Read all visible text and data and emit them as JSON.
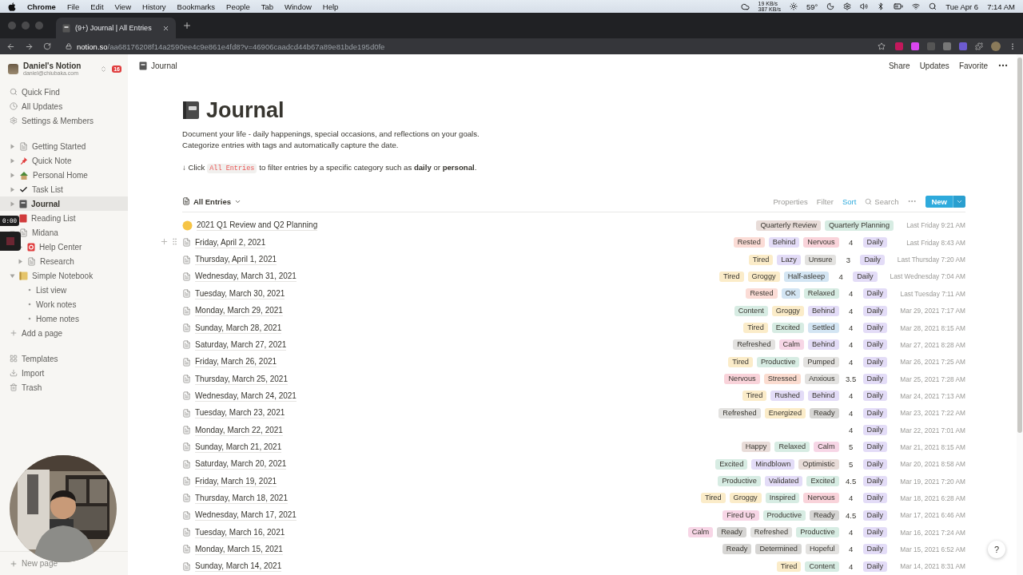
{
  "menubar": {
    "app": "Chrome",
    "menus": [
      "File",
      "Edit",
      "View",
      "History",
      "Bookmarks",
      "People",
      "Tab",
      "Window",
      "Help"
    ],
    "net_up": "19 KB/s",
    "net_down": "387 KB/s",
    "temperature": "59°",
    "date": "Tue Apr 6",
    "time": "7:14 AM"
  },
  "browser": {
    "tab_title": "(9+) Journal | All Entries",
    "url_host": "notion.so",
    "url_path": "/aa68176208f14a2590ee4c9e861e4fd8?v=46906caadcd44b67a89e81bde195d0fe"
  },
  "sidebar": {
    "workspace": "Daniel's Notion",
    "email": "daniel@chiubaka.com",
    "badge": "16",
    "actions": [
      {
        "label": "Quick Find",
        "kind": "search"
      },
      {
        "label": "All Updates",
        "kind": "clock"
      },
      {
        "label": "Settings & Members",
        "kind": "settings"
      }
    ],
    "pages": [
      {
        "label": "Getting Started",
        "kind": "page",
        "expanded": false,
        "selected": false
      },
      {
        "label": "Quick Note",
        "kind": "pin",
        "expanded": false,
        "selected": false
      },
      {
        "label": "Personal Home",
        "kind": "house",
        "expanded": false,
        "selected": false
      },
      {
        "label": "Task List",
        "kind": "check",
        "expanded": false,
        "selected": false
      },
      {
        "label": "Journal",
        "kind": "journal",
        "expanded": false,
        "selected": true
      },
      {
        "label": "Reading List",
        "kind": "book",
        "selected": false
      },
      {
        "label": "Midana",
        "kind": "page",
        "expanded": true,
        "selected": false,
        "children": [
          {
            "label": "Help Center",
            "kind": "help",
            "expanded": false,
            "selected": false
          },
          {
            "label": "Research",
            "kind": "page",
            "expanded": false,
            "selected": false
          }
        ]
      },
      {
        "label": "Simple Notebook",
        "kind": "notebook",
        "expanded": true,
        "selected": false,
        "children": [
          {
            "label": "List view",
            "kind": "bullet",
            "selected": false
          },
          {
            "label": "Work notes",
            "kind": "bullet",
            "selected": false
          },
          {
            "label": "Home notes",
            "kind": "bullet",
            "selected": false
          }
        ]
      }
    ],
    "add_page": "Add a page",
    "tools": [
      {
        "label": "Templates",
        "kind": "templates"
      },
      {
        "label": "Import",
        "kind": "import"
      },
      {
        "label": "Trash",
        "kind": "trash"
      }
    ],
    "new_page": "New page"
  },
  "recorder": {
    "timer": "0:00"
  },
  "topbar": {
    "breadcrumb": "Journal",
    "actions": [
      "Share",
      "Updates",
      "Favorite"
    ]
  },
  "page": {
    "title": "Journal",
    "description": [
      "Document your life - daily happenings, special occasions, and reflections on your goals.",
      "Categorize entries with tags and automatically capture the date."
    ],
    "hint": {
      "before": "↓ Click",
      "code": "All Entries",
      "after": "to filter entries by a specific category such as **daily** or **personal**."
    }
  },
  "view": {
    "name": "All Entries",
    "tools": [
      {
        "label": "Properties",
        "active": false
      },
      {
        "label": "Filter",
        "active": false
      },
      {
        "label": "Sort",
        "active": true
      }
    ],
    "search": "Search",
    "new_button": "New"
  },
  "rows": [
    {
      "title": "2021 Q1 Review and Q2 Planning",
      "kind": "emoji",
      "hovered": false,
      "tags": [
        {
          "label": "Quarterly Review",
          "color": "#e8dcd8"
        },
        {
          "label": "Quarterly Planning",
          "color": "#d7ece3"
        }
      ],
      "created": "Last Friday 9:21 AM"
    },
    {
      "title": "Friday, April 2, 2021",
      "kind": "page",
      "hovered": true,
      "tags": [
        {
          "label": "Rested",
          "color": "#fbdcd6"
        },
        {
          "label": "Behind",
          "color": "#e3dcf7"
        },
        {
          "label": "Nervous",
          "color": "#f9d3da"
        }
      ],
      "rating": "4",
      "type": "Daily",
      "created": "Last Friday 8:43 AM"
    },
    {
      "title": "Thursday, April 1, 2021",
      "kind": "page",
      "hovered": false,
      "tags": [
        {
          "label": "Tired",
          "color": "#fbecc9"
        },
        {
          "label": "Lazy",
          "color": "#e3dcf7"
        },
        {
          "label": "Unsure",
          "color": "#e3e2e0"
        }
      ],
      "rating": "3",
      "type": "Daily",
      "created": "Last Thursday 7:20 AM"
    },
    {
      "title": "Wednesday, March 31, 2021",
      "kind": "page",
      "hovered": false,
      "tags": [
        {
          "label": "Tired",
          "color": "#fbecc9"
        },
        {
          "label": "Groggy",
          "color": "#fbecc9"
        },
        {
          "label": "Half-asleep",
          "color": "#d3e5f3"
        }
      ],
      "rating": "4",
      "type": "Daily",
      "created": "Last Wednesday 7:04 AM"
    },
    {
      "title": "Tuesday, March 30, 2021",
      "kind": "page",
      "hovered": false,
      "tags": [
        {
          "label": "Rested",
          "color": "#fbdcd6"
        },
        {
          "label": "OK",
          "color": "#d3e5f3"
        },
        {
          "label": "Relaxed",
          "color": "#d7ece3"
        }
      ],
      "rating": "4",
      "type": "Daily",
      "created": "Last Tuesday 7:11 AM"
    },
    {
      "title": "Monday, March 29, 2021",
      "kind": "page",
      "hovered": false,
      "tags": [
        {
          "label": "Content",
          "color": "#d7ece3"
        },
        {
          "label": "Groggy",
          "color": "#fbecc9"
        },
        {
          "label": "Behind",
          "color": "#e3dcf7"
        }
      ],
      "rating": "4",
      "type": "Daily",
      "created": "Mar 29, 2021 7:17 AM"
    },
    {
      "title": "Sunday, March 28, 2021",
      "kind": "page",
      "hovered": false,
      "tags": [
        {
          "label": "Tired",
          "color": "#fbecc9"
        },
        {
          "label": "Excited",
          "color": "#d7ece3"
        },
        {
          "label": "Settled",
          "color": "#d3e5f3"
        }
      ],
      "rating": "4",
      "type": "Daily",
      "created": "Mar 28, 2021 8:15 AM"
    },
    {
      "title": "Saturday, March 27, 2021",
      "kind": "page",
      "hovered": false,
      "tags": [
        {
          "label": "Refreshed",
          "color": "#e3e2e0"
        },
        {
          "label": "Calm",
          "color": "#f7d6e6"
        },
        {
          "label": "Behind",
          "color": "#e3dcf7"
        }
      ],
      "rating": "4",
      "type": "Daily",
      "created": "Mar 27, 2021 8:28 AM"
    },
    {
      "title": "Friday, March 26, 2021",
      "kind": "page",
      "hovered": false,
      "tags": [
        {
          "label": "Tired",
          "color": "#fbecc9"
        },
        {
          "label": "Productive",
          "color": "#d7ece3"
        },
        {
          "label": "Pumped",
          "color": "#e3e2e0"
        }
      ],
      "rating": "4",
      "type": "Daily",
      "created": "Mar 26, 2021 7:25 AM"
    },
    {
      "title": "Thursday, March 25, 2021",
      "kind": "page",
      "hovered": false,
      "tags": [
        {
          "label": "Nervous",
          "color": "#f9d3da"
        },
        {
          "label": "Stressed",
          "color": "#fbdcd0"
        },
        {
          "label": "Anxious",
          "color": "#e3e2e0"
        }
      ],
      "rating": "3.5",
      "type": "Daily",
      "created": "Mar 25, 2021 7:28 AM"
    },
    {
      "title": "Wednesday, March 24, 2021",
      "kind": "page",
      "hovered": false,
      "tags": [
        {
          "label": "Tired",
          "color": "#fbecc9"
        },
        {
          "label": "Rushed",
          "color": "#e3dcf7"
        },
        {
          "label": "Behind",
          "color": "#e3dcf7"
        }
      ],
      "rating": "4",
      "type": "Daily",
      "created": "Mar 24, 2021 7:13 AM"
    },
    {
      "title": "Tuesday, March 23, 2021",
      "kind": "page",
      "hovered": false,
      "tags": [
        {
          "label": "Refreshed",
          "color": "#e3e2e0"
        },
        {
          "label": "Energized",
          "color": "#fbecc9"
        },
        {
          "label": "Ready",
          "color": "#d6d5d3"
        }
      ],
      "rating": "4",
      "type": "Daily",
      "created": "Mar 23, 2021 7:22 AM"
    },
    {
      "title": "Monday, March 22, 2021",
      "kind": "page",
      "hovered": false,
      "tags": [],
      "rating": "4",
      "type": "Daily",
      "created": "Mar 22, 2021 7:01 AM"
    },
    {
      "title": "Sunday, March 21, 2021",
      "kind": "page",
      "hovered": false,
      "tags": [
        {
          "label": "Happy",
          "color": "#e8dcd8"
        },
        {
          "label": "Relaxed",
          "color": "#d7ece3"
        },
        {
          "label": "Calm",
          "color": "#f7d6e6"
        }
      ],
      "rating": "5",
      "type": "Daily",
      "created": "Mar 21, 2021 8:15 AM"
    },
    {
      "title": "Saturday, March 20, 2021",
      "kind": "page",
      "hovered": false,
      "tags": [
        {
          "label": "Excited",
          "color": "#d7ece3"
        },
        {
          "label": "Mindblown",
          "color": "#e3dcf7"
        },
        {
          "label": "Optimistic",
          "color": "#e8dcd8"
        }
      ],
      "rating": "5",
      "type": "Daily",
      "created": "Mar 20, 2021 8:58 AM"
    },
    {
      "title": "Friday, March 19, 2021",
      "kind": "page",
      "hovered": false,
      "tags": [
        {
          "label": "Productive",
          "color": "#d7ece3"
        },
        {
          "label": "Validated",
          "color": "#e3dcf7"
        },
        {
          "label": "Excited",
          "color": "#d7ece3"
        }
      ],
      "rating": "4.5",
      "type": "Daily",
      "created": "Mar 19, 2021 7:20 AM"
    },
    {
      "title": "Thursday, March 18, 2021",
      "kind": "page",
      "hovered": false,
      "tags": [
        {
          "label": "Tired",
          "color": "#fbecc9"
        },
        {
          "label": "Groggy",
          "color": "#fbecc9"
        },
        {
          "label": "Inspired",
          "color": "#d7ece3"
        },
        {
          "label": "Nervous",
          "color": "#f9d3da"
        }
      ],
      "rating": "4",
      "type": "Daily",
      "created": "Mar 18, 2021 6:28 AM"
    },
    {
      "title": "Wednesday, March 17, 2021",
      "kind": "page",
      "hovered": false,
      "tags": [
        {
          "label": "Fired Up",
          "color": "#f7d6e6"
        },
        {
          "label": "Productive",
          "color": "#d7ece3"
        },
        {
          "label": "Ready",
          "color": "#d6d5d3"
        }
      ],
      "rating": "4.5",
      "type": "Daily",
      "created": "Mar 17, 2021 6:46 AM"
    },
    {
      "title": "Tuesday, March 16, 2021",
      "kind": "page",
      "hovered": false,
      "tags": [
        {
          "label": "Calm",
          "color": "#f7d6e6"
        },
        {
          "label": "Ready",
          "color": "#d6d5d3"
        },
        {
          "label": "Refreshed",
          "color": "#e3e2e0"
        },
        {
          "label": "Productive",
          "color": "#d7ece3"
        }
      ],
      "rating": "4",
      "type": "Daily",
      "created": "Mar 16, 2021 7:24 AM"
    },
    {
      "title": "Monday, March 15, 2021",
      "kind": "page",
      "hovered": false,
      "tags": [
        {
          "label": "Ready",
          "color": "#d6d5d3"
        },
        {
          "label": "Determined",
          "color": "#d6d5d3"
        },
        {
          "label": "Hopeful",
          "color": "#e3e2e0"
        }
      ],
      "rating": "4",
      "type": "Daily",
      "created": "Mar 15, 2021 6:52 AM"
    },
    {
      "title": "Sunday, March 14, 2021",
      "kind": "page",
      "hovered": false,
      "tags": [
        {
          "label": "Tired",
          "color": "#fbecc9"
        },
        {
          "label": "Content",
          "color": "#d7ece3"
        }
      ],
      "rating": "4",
      "type": "Daily",
      "created": "Mar 14, 2021 8:31 AM"
    }
  ],
  "help": {
    "label": "?"
  }
}
